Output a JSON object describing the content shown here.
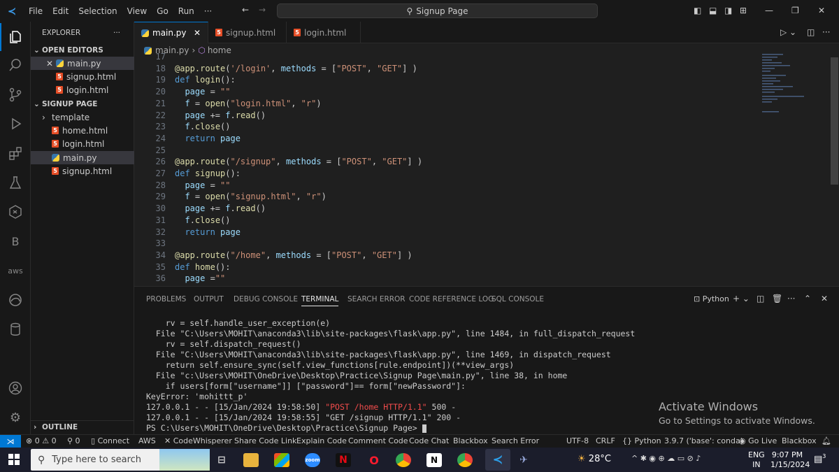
{
  "titlebar": {
    "menus": [
      "File",
      "Edit",
      "Selection",
      "View",
      "Go",
      "Run",
      "···"
    ],
    "command_center": "Signup Page"
  },
  "sidebar": {
    "title": "EXPLORER",
    "more": "···",
    "open_editors_label": "OPEN EDITORS",
    "open_editors": [
      "main.py",
      "signup.html",
      "login.html"
    ],
    "folder_label": "SIGNUP PAGE",
    "files": [
      "template",
      "home.html",
      "login.html",
      "main.py",
      "signup.html"
    ],
    "outline_label": "OUTLINE"
  },
  "tabs": [
    "main.py",
    "signup.html",
    "login.html"
  ],
  "breadcrumb": {
    "file": "main.py",
    "symbol": "home"
  },
  "editor": {
    "lines": [
      {
        "n": "17",
        "t": ""
      },
      {
        "n": "18",
        "t": "@app.route('/login', methods = [\"POST\", \"GET\"] )"
      },
      {
        "n": "19",
        "t": "def login():"
      },
      {
        "n": "20",
        "t": "  page = \"\""
      },
      {
        "n": "21",
        "t": "  f = open(\"login.html\", \"r\")"
      },
      {
        "n": "22",
        "t": "  page += f.read()"
      },
      {
        "n": "23",
        "t": "  f.close()"
      },
      {
        "n": "24",
        "t": "  return page"
      },
      {
        "n": "25",
        "t": ""
      },
      {
        "n": "26",
        "t": "@app.route(\"/signup\", methods = [\"POST\", \"GET\"] )"
      },
      {
        "n": "27",
        "t": "def signup():"
      },
      {
        "n": "28",
        "t": "  page = \"\""
      },
      {
        "n": "29",
        "t": "  f = open(\"signup.html\", \"r\")"
      },
      {
        "n": "30",
        "t": "  page += f.read()"
      },
      {
        "n": "31",
        "t": "  f.close()"
      },
      {
        "n": "32",
        "t": "  return page"
      },
      {
        "n": "33",
        "t": ""
      },
      {
        "n": "34",
        "t": "@app.route(\"/home\", methods = [\"POST\", \"GET\"] )"
      },
      {
        "n": "35",
        "t": "def home():"
      },
      {
        "n": "36",
        "t": "  page =\"\""
      }
    ]
  },
  "panel": {
    "tabs": [
      "PROBLEMS",
      "OUTPUT",
      "DEBUG CONSOLE",
      "TERMINAL",
      "SEARCH ERROR",
      "CODE REFERENCE LOG",
      "SQL CONSOLE"
    ],
    "active_tab": "TERMINAL",
    "shell": "Python",
    "terminal_lines": [
      "    rv = self.handle_user_exception(e)",
      "  File \"C:\\Users\\MOHIT\\anaconda3\\lib\\site-packages\\flask\\app.py\", line 1484, in full_dispatch_request",
      "    rv = self.dispatch_request()",
      "  File \"C:\\Users\\MOHIT\\anaconda3\\lib\\site-packages\\flask\\app.py\", line 1469, in dispatch_request",
      "    return self.ensure_sync(self.view_functions[rule.endpoint])(**view_args)",
      "  File \"c:\\Users\\MOHIT\\OneDrive\\Desktop\\Practice\\Signup Page\\main.py\", line 38, in home",
      "    if users[form[\"username\"]] [\"password\"]== form[\"newPassword\"]:",
      "KeyError: 'mohittt_p'",
      "127.0.0.1 - - [15/Jan/2024 19:58:50] \"POST /home HTTP/1.1\" 500 -",
      "127.0.0.1 - - [15/Jan/2024 19:58:55] \"GET /signup HTTP/1.1\" 200 -",
      "PS C:\\Users\\MOHIT\\OneDrive\\Desktop\\Practice\\Signup Page> "
    ]
  },
  "watermark": {
    "title": "Activate Windows",
    "subtitle": "Go to Settings to activate Windows."
  },
  "statusbar": {
    "problems": "⊗ 0 ⚠ 0",
    "ports": "⚲ 0",
    "items_left": [
      "Connect",
      "AWS",
      "CodeWhisperer",
      "Share Code Link",
      "Explain Code",
      "Comment Code",
      "Code Chat",
      "Blackbox",
      "Search Error"
    ],
    "encoding": "UTF-8",
    "eol": "CRLF",
    "language": "Python",
    "interpreter": "3.9.7 ('base': conda)",
    "golive": "Go Live",
    "blackbox": "Blackbox"
  },
  "taskbar": {
    "search_placeholder": "Type here to search",
    "weather": "28°C",
    "lang": "ENG",
    "region": "IN",
    "time": "9:07 PM",
    "date": "1/15/2024",
    "notification_count": "3"
  },
  "colors": {
    "accent": "#0078d4",
    "background": "#1f1f1f",
    "sidebar": "#181818"
  }
}
